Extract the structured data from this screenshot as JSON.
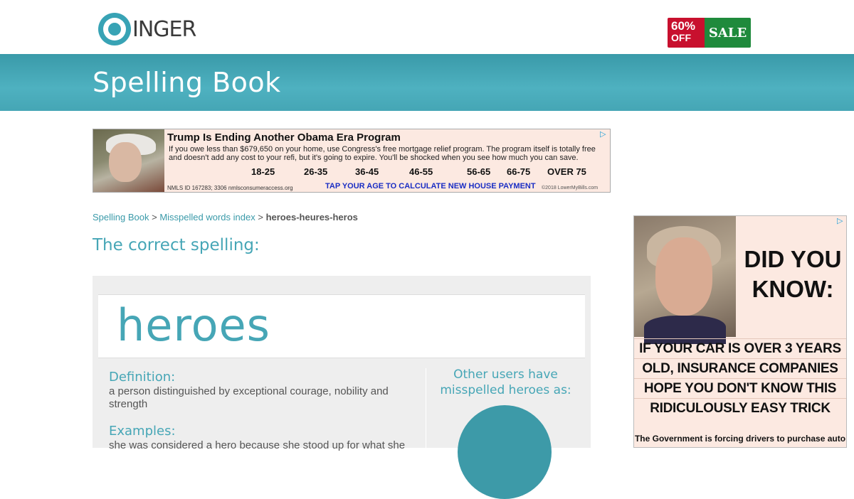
{
  "header": {
    "logo_text": "INGER",
    "sale": {
      "pct": "60%",
      "off": "OFF",
      "word": "SALE"
    },
    "band_title": "Spelling Book"
  },
  "ad_top": {
    "title": "Trump Is Ending Another Obama Era Program",
    "body": "If you owe less than $679,650 on your home, use Congress's free mortgage relief program. The program itself is totally free and doesn't add any cost to your refi, but it's going to expire. You'll be shocked when you see how much you can save.",
    "ages": [
      "18-25",
      "26-35",
      "36-45",
      "46-55",
      "56-65",
      "66-75",
      "OVER 75"
    ],
    "nmls": "NMLS ID 167283; 3306  nmlsconsumeraccess.org",
    "cta": "TAP YOUR AGE TO CALCULATE NEW HOUSE PAYMENT",
    "copyright": "©2018  LowerMyBills.com"
  },
  "breadcrumb": {
    "home": "Spelling Book",
    "sep1": " > ",
    "index": "Misspelled words index",
    "sep2": " > ",
    "current": "heroes-heures-heros"
  },
  "main": {
    "heading": "The correct spelling:",
    "word": "heroes",
    "definition_label": "Definition:",
    "definition": "a person distinguished by exceptional courage, nobility and strength",
    "examples_label": "Examples:",
    "example": "she was considered a hero because she stood up for what she",
    "other_users": "Other users have misspelled heroes as:"
  },
  "ad_side": {
    "headline": "DID YOU KNOW:",
    "lines": [
      "IF YOUR CAR IS OVER 3 YEARS",
      "OLD, INSURANCE COMPANIES",
      "HOPE YOU DON'T KNOW THIS",
      "RIDICULOUSLY EASY TRICK"
    ],
    "small": "The Government is forcing drivers to purchase auto"
  },
  "colors": {
    "teal": "#46a6b6",
    "band": "#4eb1c0",
    "sale_red": "#c8102e",
    "sale_green": "#1f8a3c"
  },
  "icons": {
    "ad_choices": "adchoices-icon"
  }
}
